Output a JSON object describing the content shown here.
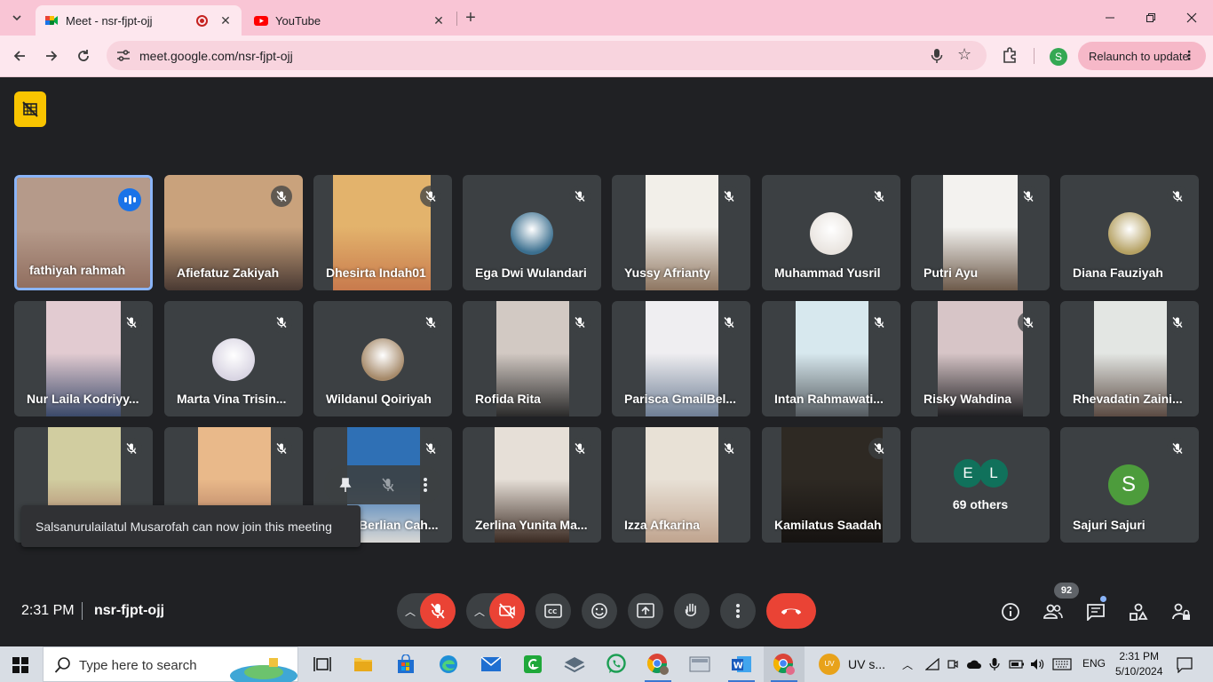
{
  "browser": {
    "tabs": [
      {
        "label": "Meet - nsr-fjpt-ojj",
        "active": true,
        "recording": true
      },
      {
        "label": "YouTube",
        "active": false
      }
    ],
    "url": "meet.google.com/nsr-fjpt-ojj",
    "profile_initial": "S",
    "relaunch_label": "Relaunch to update"
  },
  "participants": [
    {
      "name": "fathiyah rahmah",
      "speaking": true
    },
    {
      "name": "Afiefatuz Zakiyah"
    },
    {
      "name": "Dhesirta Indah01"
    },
    {
      "name": "Ega Dwi Wulandari"
    },
    {
      "name": "Yussy Afrianty"
    },
    {
      "name": "Muhammad Yusril"
    },
    {
      "name": "Putri Ayu"
    },
    {
      "name": "Diana Fauziyah"
    },
    {
      "name": "Nur Laila Kodriyy..."
    },
    {
      "name": "Marta Vina Trisin..."
    },
    {
      "name": "Wildanul Qoiriyah"
    },
    {
      "name": "Rofida Rita"
    },
    {
      "name": "Parisca GmailBel..."
    },
    {
      "name": "Intan Rahmawati..."
    },
    {
      "name": "Risky Wahdina"
    },
    {
      "name": "Rhevadatin Zaini..."
    },
    {
      "name": ""
    },
    {
      "name": ""
    },
    {
      "name": "Berlian Cah..."
    },
    {
      "name": "Zerlina Yunita Ma..."
    },
    {
      "name": "Izza Afkarina"
    },
    {
      "name": "Kamilatus Saadah"
    },
    {
      "name": "Sajuri Sajuri",
      "initial": "S"
    }
  ],
  "others": {
    "label": "69 others",
    "initials": [
      "E",
      "L"
    ]
  },
  "toast": "Salsanurulailatul Musarofah can now join this meeting",
  "meeting": {
    "time": "2:31 PM",
    "code": "nsr-fjpt-ojj",
    "people_count": "92"
  },
  "taskbar": {
    "search_placeholder": "Type here to search",
    "uv_label": "UV s...",
    "language": "ENG",
    "time": "2:31 PM",
    "date": "5/10/2024",
    "uv_badge": "UV"
  },
  "colors": {
    "accent_blue": "#1a73e8",
    "end_red": "#ea4335",
    "chrome_pink": "#f9c5d5",
    "stage": "#202124"
  }
}
